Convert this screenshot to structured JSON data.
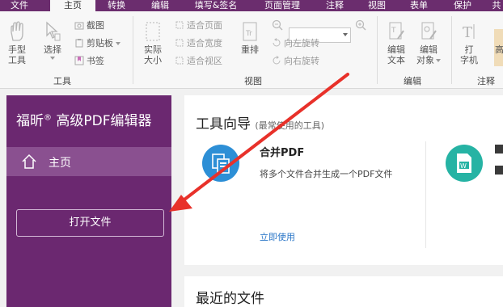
{
  "menu": {
    "tabs": [
      {
        "label": "文件",
        "active": false
      },
      {
        "label": "主页",
        "active": true
      },
      {
        "label": "转换",
        "active": false
      },
      {
        "label": "编辑",
        "active": false
      },
      {
        "label": "填写&签名",
        "active": false
      },
      {
        "label": "页面管理",
        "active": false
      },
      {
        "label": "注释",
        "active": false
      },
      {
        "label": "视图",
        "active": false
      },
      {
        "label": "表单",
        "active": false
      },
      {
        "label": "保护",
        "active": false
      },
      {
        "label": "共",
        "active": false
      }
    ]
  },
  "ribbon": {
    "hand_tool": {
      "line1": "手型",
      "line2": "工具"
    },
    "select": "选择",
    "screenshot": "截图",
    "clipboard": "剪贴板",
    "bookmark": "书签",
    "tools_group": "工具",
    "actual_size": {
      "line1": "实际",
      "line2": "大小"
    },
    "fit_page": "适合页面",
    "fit_width": "适合宽度",
    "fit_visible": "适合视区",
    "reflow": "重排",
    "rotate_left": "向左旋转",
    "rotate_right": "向右旋转",
    "view_group": "视图",
    "edit_text": {
      "line1": "编辑",
      "line2": "文本"
    },
    "edit_object": {
      "line1": "编辑",
      "line2": "对象"
    },
    "edit_group": "编辑",
    "typewriter": {
      "line1": "打",
      "line2": "字机"
    },
    "highlight": "高",
    "comment_group": "注释"
  },
  "sidebar": {
    "brand": "福昕",
    "brand_reg": "®",
    "brand_product": " 高级PDF编辑器",
    "home_label": "主页",
    "open_button": "打开文件"
  },
  "main": {
    "tool_guide_title": "工具向导",
    "tool_guide_subtitle": "(最常使用的工具)",
    "merge_title": "合并PDF",
    "merge_desc": "将多个文件合并生成一个PDF文件",
    "merge_link": "立即使用",
    "recent_title": "最近的文件"
  },
  "colors": {
    "brand_purple": "#6b2870",
    "merge_icon": "#2d8fd6",
    "tool2_icon": "#26b3a4",
    "annotation_arrow": "#e8312a"
  }
}
